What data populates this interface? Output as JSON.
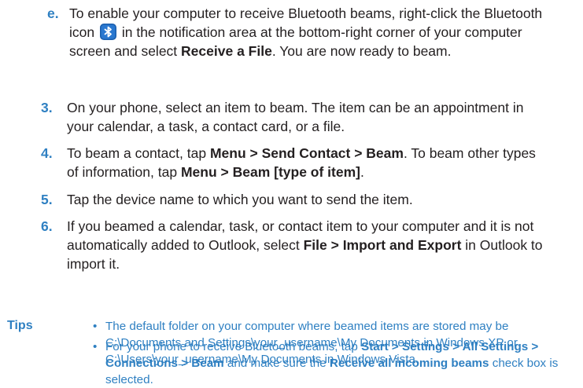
{
  "step_e": {
    "num": "e.",
    "part1": "To enable your computer to receive Bluetooth beams, right-click the Bluetooth icon",
    "part2": "in the notification area at the bottom-right corner of your computer screen and select",
    "bold1": "Receive a File",
    "part3": ". You are now ready to beam.",
    "icon": "bluetooth-icon"
  },
  "step3": {
    "num": "3.",
    "text": "On your phone, select an item to beam. The item can be an appointment in your calendar, a task, a contact card, or a file."
  },
  "step4": {
    "num": "4.",
    "t1": "To beam a contact, tap",
    "b1": "Menu > Send Contact > Beam",
    "t2": ". To beam other types of information, tap",
    "b2": "Menu > Beam [type of item]",
    "t3": "."
  },
  "step5": {
    "num": "5.",
    "text": "Tap the device name to which you want to send the item."
  },
  "step6": {
    "num": "6.",
    "t1": "If you beamed a calendar, task, or contact item to your computer and it is not automatically added to Outlook, select",
    "b1": "File > Import and Export",
    "t2": "in Outlook to import it."
  },
  "tips": {
    "label": "Tips",
    "bullet": "•",
    "tip1": "The default folder on your computer where beamed items are stored may be C:\\Documents and Settings\\your_username\\My Documents in Windows XP or C:\\Users\\your_username\\My Documents in Windows Vista.",
    "tip2_t1": "For your phone to receive Bluetooth beams, tap",
    "tip2_b1": "Start > Settings > All Settings > Connections > Beam",
    "tip2_t2": "and make sure the",
    "tip2_b2": "Receive all incoming beams",
    "tip2_t3": "check box is selected."
  },
  "colors": {
    "accent": "#2f80c2",
    "text": "#231f20"
  }
}
